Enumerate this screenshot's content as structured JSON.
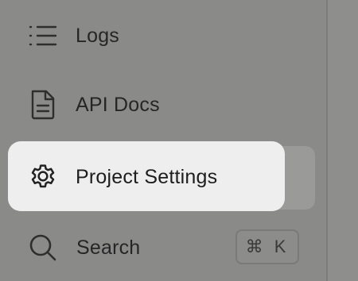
{
  "nav": {
    "logs": {
      "label": "Logs",
      "icon": "list-icon"
    },
    "api_docs": {
      "label": "API Docs",
      "icon": "document-icon"
    },
    "project_settings": {
      "label": "Project Settings",
      "icon": "gear-icon",
      "active": true
    },
    "search": {
      "label": "Search",
      "icon": "search-icon",
      "shortcut": "⌘ K"
    }
  },
  "colors": {
    "sidebar_bg": "#8a8a89",
    "active_bg": "#eeeeee",
    "text": "#262626"
  }
}
